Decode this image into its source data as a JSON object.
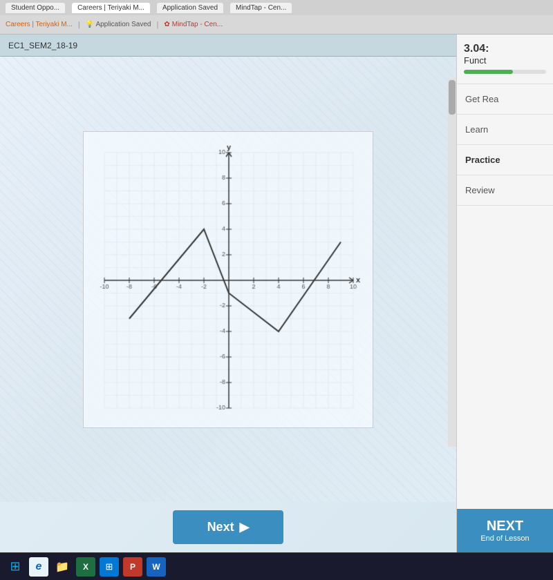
{
  "browser": {
    "tabs": [
      {
        "label": "Student Oppo...",
        "active": false
      },
      {
        "label": "Careers | Teriyaki M...",
        "active": true
      },
      {
        "label": "Application Saved",
        "active": false
      },
      {
        "label": "MindTap - Cen...",
        "active": false
      }
    ],
    "nav_items": [
      {
        "label": "Careers | Teriyaki M...",
        "type": "orange"
      },
      {
        "label": "Application Saved",
        "type": "saved"
      },
      {
        "label": "MindTap - Cen...",
        "type": "mindtap"
      }
    ]
  },
  "header": {
    "breadcrumb": "EC1_SEM2_18-19"
  },
  "sidebar": {
    "section_number": "3.04:",
    "section_title": "Funct",
    "progress_percent": 60,
    "nav_items": [
      {
        "label": "Get Rea"
      },
      {
        "label": "Learn"
      },
      {
        "label": "Practice"
      },
      {
        "label": "Review"
      }
    ],
    "next_button": {
      "label": "NEXT",
      "sublabel": "End of Lesson"
    }
  },
  "graph": {
    "x_min": -10,
    "x_max": 10,
    "y_min": -10,
    "y_max": 10,
    "x_label": "x",
    "y_label": "y",
    "tick_interval": 2,
    "polyline_points": [
      [
        -8,
        -3
      ],
      [
        -2,
        4
      ],
      [
        0,
        -1
      ],
      [
        4,
        -4
      ],
      [
        9,
        3
      ]
    ]
  },
  "buttons": {
    "next": {
      "label": "Next",
      "arrow": "▶"
    }
  },
  "taskbar": {
    "icons": [
      {
        "name": "windows",
        "symbol": "⊞"
      },
      {
        "name": "ie",
        "symbol": "e"
      },
      {
        "name": "folder",
        "symbol": "📁"
      },
      {
        "name": "excel",
        "symbol": "X"
      },
      {
        "name": "store",
        "symbol": "🪟"
      },
      {
        "name": "powerpoint",
        "symbol": "P"
      },
      {
        "name": "word",
        "symbol": "W"
      }
    ]
  }
}
